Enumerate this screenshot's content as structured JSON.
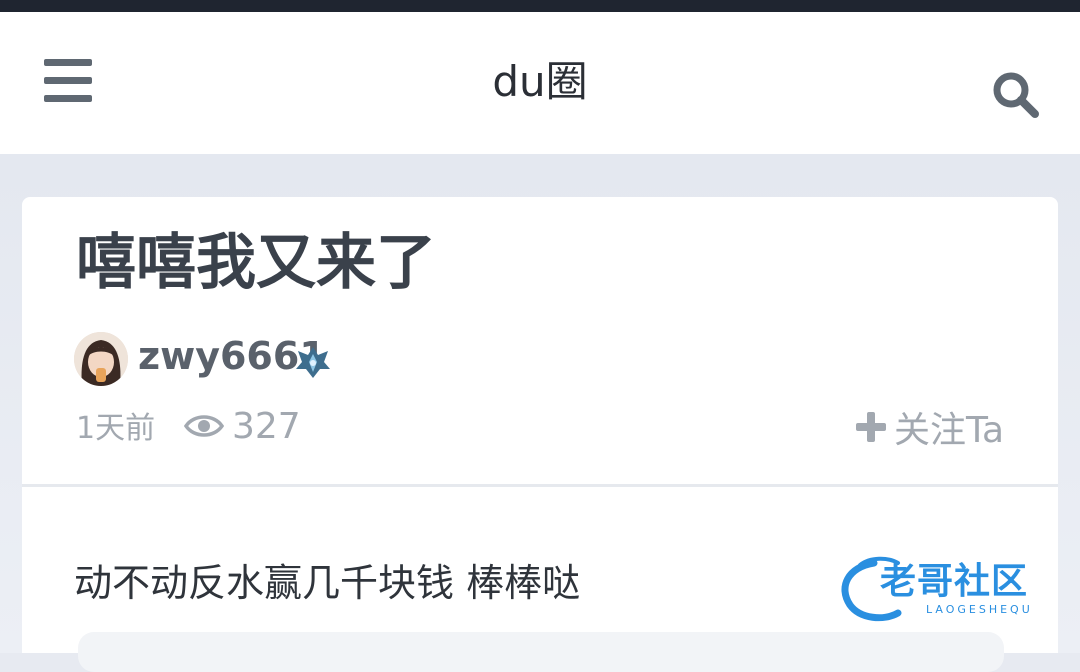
{
  "header": {
    "title": "du圈",
    "menu_icon": "hamburger-menu-icon",
    "search_icon": "search-icon"
  },
  "post": {
    "title": "嘻嘻我又来了",
    "author": {
      "name": "zwy6661",
      "badge_icon": "rank-badge-icon"
    },
    "time": "1天前",
    "views": "327",
    "follow_label": "关注Ta",
    "body": "动不动反水赢几千块钱 棒棒哒"
  },
  "watermark": {
    "text": "老哥社区",
    "sub": "LAOGESHEQU"
  },
  "colors": {
    "top_bar": "#1f2530",
    "background": "#e7eaf1",
    "title_text": "#3a414b",
    "meta_text": "#a2a8b0",
    "watermark_blue": "#2a8fe0"
  }
}
